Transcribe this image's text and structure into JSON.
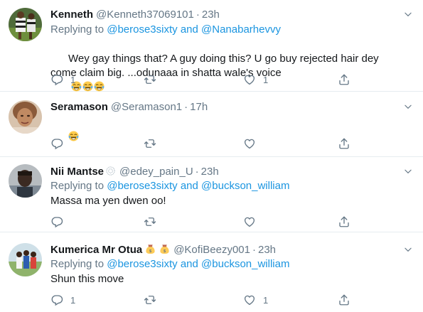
{
  "tweets": [
    {
      "name": "Kenneth",
      "handle": "@Kenneth37069101",
      "time": "23h",
      "reply_prefix": "Replying to",
      "reply_mention1": "@berose3sixty",
      "reply_and": "and",
      "reply_mention2": "@Nanabarhevvy",
      "text": "Wey gay things that? A guy doing this? U go buy rejected hair dey come claim big. ...odunaaa in shatta wale's voice",
      "emoji": [
        "joy-emoji",
        "joy-emoji",
        "joy-emoji"
      ],
      "reply_count": "1",
      "like_count": "1"
    },
    {
      "name": "Seramason",
      "handle": "@Seramason1",
      "time": "17h",
      "emoji": [
        "joy-emoji"
      ]
    },
    {
      "name": "Nii Mantse",
      "handle": "@edey_pain_U",
      "time": "23h",
      "reply_prefix": "Replying to",
      "reply_mention1": "@berose3sixty",
      "reply_and": "and",
      "reply_mention2": "@buckson_william",
      "text": "Massa ma yen dwen oo!"
    },
    {
      "name": "Kumerica Mr Otua",
      "name_emoji": [
        "money-bag-emoji",
        "money-bag-emoji"
      ],
      "handle": "@KofiBeezy001",
      "time": "23h",
      "reply_prefix": "Replying to",
      "reply_mention1": "@berose3sixty",
      "reply_and": "and",
      "reply_mention2": "@buckson_william",
      "text": "Shun this move",
      "reply_count": "1",
      "like_count": "1"
    }
  ],
  "colors": {
    "text": "#14171a",
    "secondary": "#657786",
    "link": "#1b95e0",
    "divider": "#e6ecf0"
  }
}
